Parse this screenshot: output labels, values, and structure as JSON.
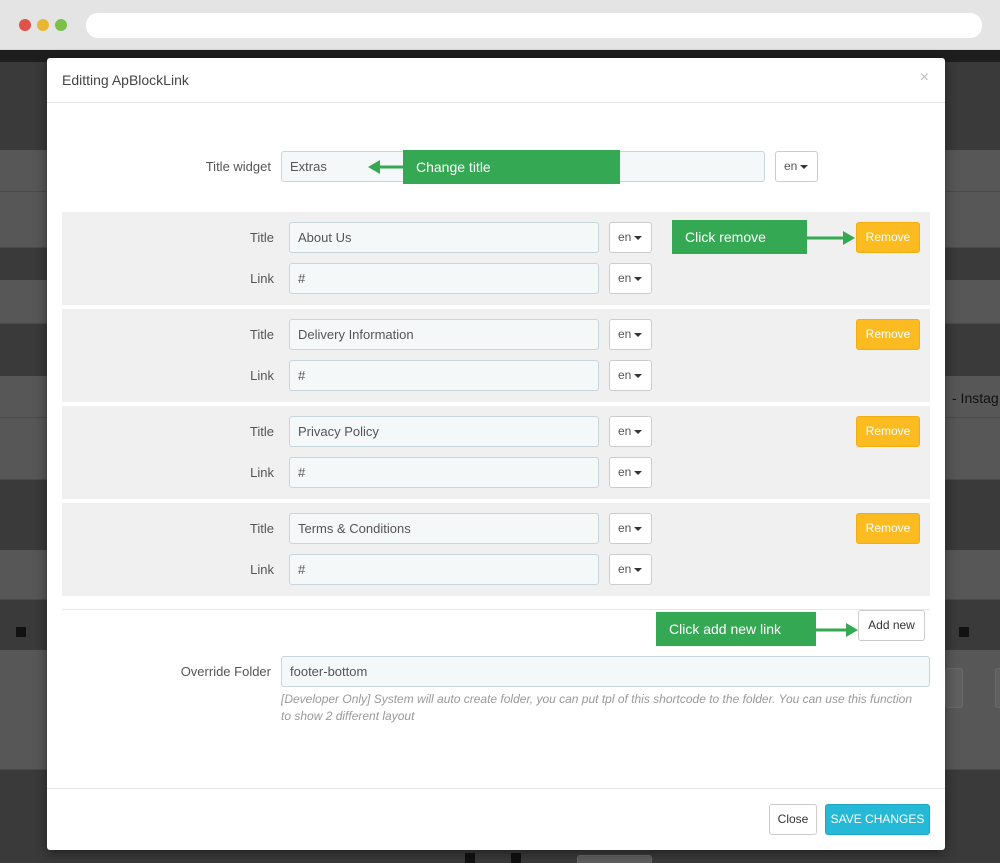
{
  "modal": {
    "title": "Editting ApBlockLink",
    "close_glyph": "×"
  },
  "title_widget": {
    "label": "Title widget",
    "value": "Extras",
    "lang": "en"
  },
  "links": [
    {
      "title_label": "Title",
      "title_value": "About Us",
      "link_label": "Link",
      "link_value": "#",
      "lang": "en",
      "remove_label": "Remove"
    },
    {
      "title_label": "Title",
      "title_value": "Delivery Information",
      "link_label": "Link",
      "link_value": "#",
      "lang": "en",
      "remove_label": "Remove"
    },
    {
      "title_label": "Title",
      "title_value": "Privacy Policy",
      "link_label": "Link",
      "link_value": "#",
      "lang": "en",
      "remove_label": "Remove"
    },
    {
      "title_label": "Title",
      "title_value": "Terms & Conditions",
      "link_label": "Link",
      "link_value": "#",
      "lang": "en",
      "remove_label": "Remove"
    }
  ],
  "add_new_label": "Add new",
  "override_folder": {
    "label": "Override Folder",
    "value": "footer-bottom",
    "help": "[Developer Only] System will auto create folder, you can put tpl of this shortcode to the folder. You can use this function to show 2 different layout"
  },
  "footer": {
    "close_label": "Close",
    "save_label": "SAVE CHANGES"
  },
  "annotations": {
    "change_title": "Change title",
    "click_remove": "Click remove",
    "click_add": "Click add new link"
  },
  "background": {
    "partial_text": "- Instag"
  },
  "colors": {
    "remove": "#fbbb21",
    "save": "#25b9d7",
    "annotation": "#34a853"
  }
}
